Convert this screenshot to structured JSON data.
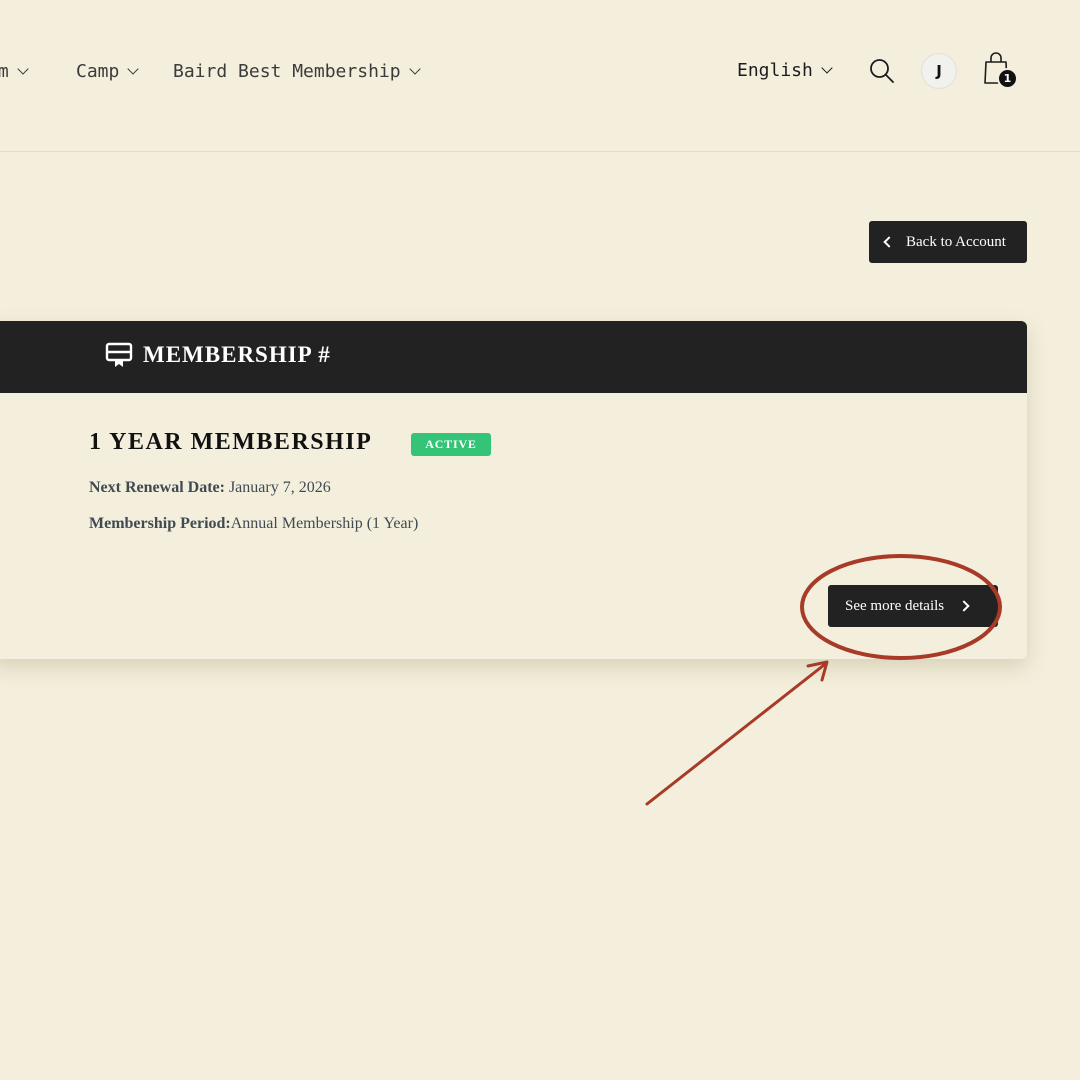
{
  "header": {
    "nav": [
      {
        "label": "om"
      },
      {
        "label": "Camp"
      },
      {
        "label": "Baird Best Membership"
      }
    ],
    "language": "English",
    "avatar_initial": "J",
    "cart_count": "1"
  },
  "actions": {
    "back_label": "Back to Account"
  },
  "membership": {
    "header_title": "MEMBERSHIP #",
    "plan_name": "1 YEAR MEMBERSHIP",
    "status": "ACTIVE",
    "renewal_label": "Next Renewal Date:",
    "renewal_value": " January 7, 2026",
    "period_label": "Membership Period:",
    "period_value": "Annual Membership (1 Year)",
    "details_label": "See more details"
  },
  "colors": {
    "background": "#f4efdc",
    "dark": "#222222",
    "active_badge": "#34c478",
    "annotation": "#a83a28"
  },
  "icons": {
    "search": "search-icon",
    "cart": "shopping-bag-icon",
    "membership": "certificate-icon",
    "back": "chevron-left-icon",
    "details": "chevron-right-icon"
  }
}
